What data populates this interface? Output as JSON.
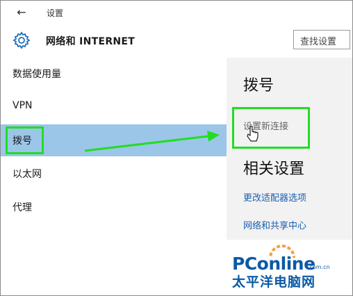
{
  "window": {
    "title": "设置",
    "back_icon": "back-arrow-icon"
  },
  "header": {
    "icon": "gear-icon",
    "title": "网络和 INTERNET",
    "search_placeholder": "查找设置"
  },
  "nav": {
    "items": [
      {
        "label": "数据使用量"
      },
      {
        "label": "VPN"
      },
      {
        "label": "拨号",
        "selected": true
      },
      {
        "label": "以太网"
      },
      {
        "label": "代理"
      }
    ]
  },
  "content": {
    "heading": "拨号",
    "new_connection": "设置新连接",
    "related_heading": "相关设置",
    "links": [
      "更改适配器选项",
      "网络和共享中心"
    ]
  },
  "annotation": {
    "highlight_color": "#22dd22",
    "arrow_color": "#22dd22"
  },
  "watermark": {
    "brand": "PConline",
    "domain": ".com.cn",
    "cn": "太平洋电脑网"
  },
  "colors": {
    "selected_bg": "#9bc6e8",
    "link": "#1a5fb4",
    "right_pane_bg": "#f2f2f2"
  }
}
